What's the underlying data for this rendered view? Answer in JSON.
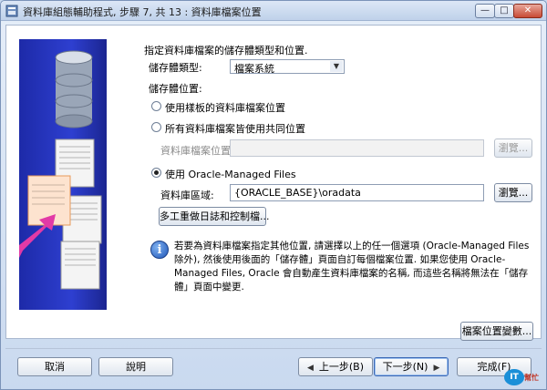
{
  "window": {
    "title": "資料庫組態輔助程式, 步驟 7, 共 13 : 資料庫檔案位置",
    "minimize_glyph": "—",
    "maximize_glyph": "□",
    "close_glyph": "✕"
  },
  "form": {
    "heading": "指定資料庫檔案的儲存體類型和位置.",
    "storage_type_label": "儲存體類型:",
    "storage_type_value": "檔案系統",
    "storage_location_label": "儲存體位置:",
    "option_template": "使用樣板的資料庫檔案位置",
    "option_common": "所有資料庫檔案皆使用共同位置",
    "db_file_location_label": "資料庫檔案位置:",
    "db_file_location_value": "",
    "browse_label": "瀏覽...",
    "option_omf": "使用 Oracle-Managed Files",
    "db_area_label": "資料庫區域:",
    "db_area_value": "{ORACLE_BASE}\\oradata",
    "multiplex_button": "多工重做日誌和控制檔...",
    "info_text": "若要為資料庫檔案指定其他位置, 請選擇以上的任一個選項 (Oracle-Managed Files 除外), 然後使用後面的「儲存體」頁面自訂每個檔案位置. 如果您使用 Oracle-Managed Files, Oracle 會自動產生資料庫檔案的名稱, 而這些名稱將無法在「儲存體」頁面中變更.",
    "file_location_vars_button": "檔案位置變數..."
  },
  "footer": {
    "cancel": "取消",
    "help": "說明",
    "back": "上一步(B)",
    "next": "下一步(N)",
    "finish": "完成(F)"
  },
  "watermark": {
    "logo": "IT",
    "sub": "幫忙"
  },
  "icons": {
    "info": "i",
    "back_arrow": "◀",
    "next_arrow": "▶",
    "combo_arrow": "▼"
  },
  "selected_option": "omf"
}
